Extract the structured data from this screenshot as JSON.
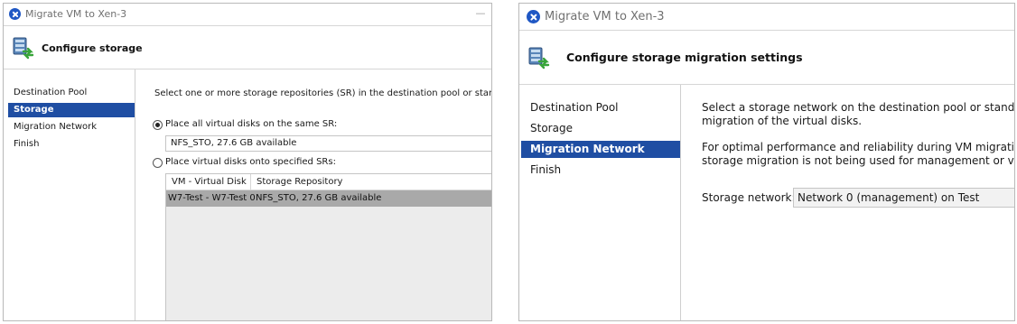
{
  "left_window": {
    "title": "Migrate VM to Xen-3",
    "header_title": "Configure storage",
    "nav": [
      "Destination Pool",
      "Storage",
      "Migration Network",
      "Finish"
    ],
    "instruction": "Select one or more storage repositories (SR) in the destination pool or standalone server.",
    "radio_same_sr": "Place all virtual disks on the same SR:",
    "sr_value": "NFS_STO, 27.6 GB available",
    "radio_specified_srs": "Place virtual disks onto specified SRs:",
    "grid_headers": [
      "VM - Virtual Disk",
      "Storage Repository"
    ],
    "grid_row": [
      "W7-Test - W7-Test 0",
      "NFS_STO, 27.6 GB available"
    ],
    "minimize_symbol": "—"
  },
  "right_window": {
    "title": "Migrate VM to Xen-3",
    "header_title": "Configure storage migration settings",
    "nav": [
      "Destination Pool",
      "Storage",
      "Migration Network",
      "Finish"
    ],
    "para1_line1": "Select a storage network on the destination pool or standalone serve",
    "para1_line2": "migration of the virtual disks.",
    "para2_line1": "For optimal performance and reliability during VM migration, ensure",
    "para2_line2": "storage migration is not being used for management or virtual mac",
    "storage_network_label": "Storage network:",
    "storage_network_value": "Network 0 (management) on Test"
  },
  "colors": {
    "selection_blue": "#1f4ea3",
    "app_icon_blue": "#1f57c4",
    "grid_row_gray": "#a9a9a9"
  }
}
